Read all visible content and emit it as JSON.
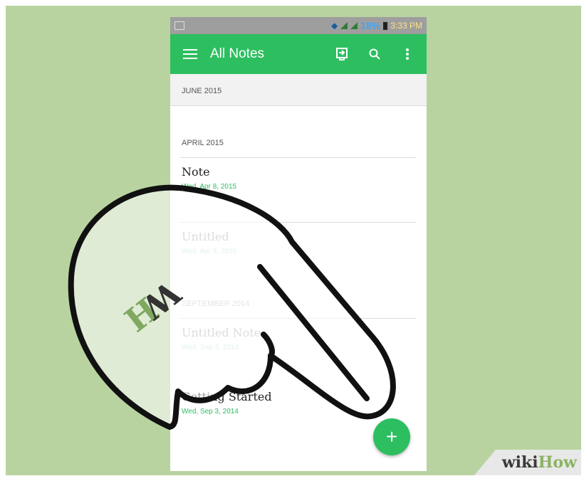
{
  "app_bar": {
    "title": "All Notes"
  },
  "status_bar": {
    "battery_percent": "18%",
    "time": "3:33 PM"
  },
  "sections": [
    {
      "header": "JUNE 2015"
    },
    {
      "header": "APRIL 2015"
    },
    {
      "header": "SEPTEMBER 2014"
    }
  ],
  "notes": [
    {
      "title": "Note",
      "date": "Wed, Apr 8, 2015"
    },
    {
      "title": "Untitled",
      "date": "Wed, Apr 8, 2015"
    },
    {
      "title": "Untitled Note",
      "date": "Wed, Sep 3, 2014"
    },
    {
      "title": "Getting Started",
      "date": "Wed, Sep 3, 2014"
    }
  ],
  "fab": {
    "label": "+"
  },
  "watermark": {
    "wiki": "wiki",
    "how": "How",
    "hand_logo": "WH"
  },
  "colors": {
    "accent": "#2dbe60",
    "background": "#b8d3a0",
    "status_bar": "#9e9e9e"
  }
}
